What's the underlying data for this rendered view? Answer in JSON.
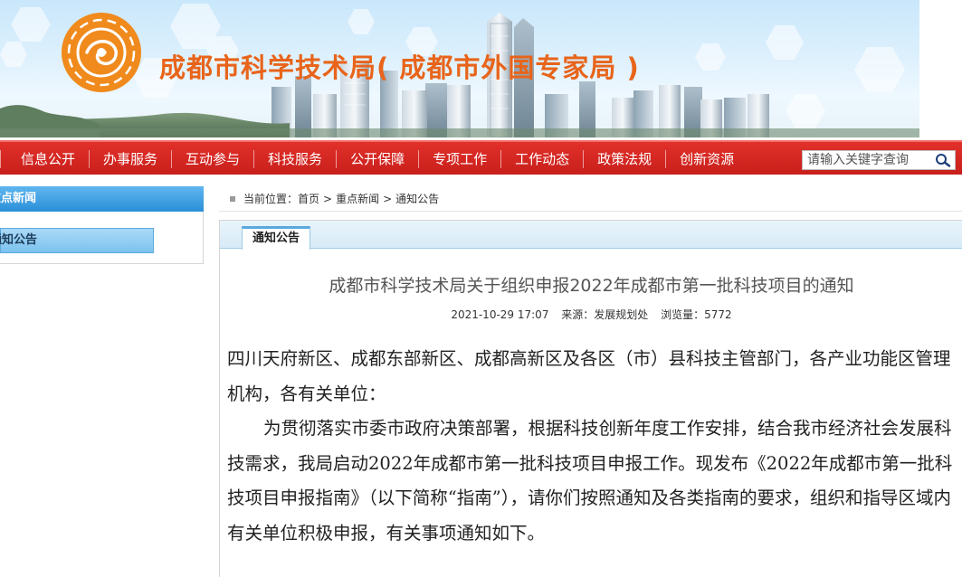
{
  "header": {
    "site_title": "成都市科学技术局( 成都市外国专家局 )"
  },
  "nav": {
    "items": [
      {
        "label": "信息公开"
      },
      {
        "label": "办事服务"
      },
      {
        "label": "互动参与"
      },
      {
        "label": "科技服务"
      },
      {
        "label": "公开保障"
      },
      {
        "label": "专项工作"
      },
      {
        "label": "工作动态"
      },
      {
        "label": "政策法规"
      },
      {
        "label": "创新资源"
      }
    ],
    "search_placeholder": "请输入关键字查询",
    "search_icon": "search-icon"
  },
  "sidebar": {
    "heading": "重点新闻",
    "items": [
      {
        "label": "通知公告"
      }
    ]
  },
  "breadcrumb": {
    "prefix": "当前位置：",
    "items": [
      "首页",
      "重点新闻",
      "通知公告"
    ],
    "separator": ">"
  },
  "panel": {
    "tab_label": "通知公告"
  },
  "article": {
    "title": "成都市科学技术局关于组织申报2022年成都市第一批科技项目的通知",
    "date": "2021-10-29 17:07",
    "source": "来源：发展规划处",
    "views_label": "浏览量：",
    "views": "5772",
    "paragraphs": [
      "四川天府新区、成都东部新区、成都高新区及各区（市）县科技主管部门，各产业功能区管理机构，各有关单位：",
      "为贯彻落实市委市政府决策部署，根据科技创新年度工作安排，结合我市经济社会发展科技需求，我局启动2022年成都市第一批科技项目申报工作。现发布《2022年成都市第一批科技项目申报指南》（以下简称“指南”），请你们按照通知及各类指南的要求，组织和指导区域内有关单位积极申报，有关事项通知如下。"
    ]
  },
  "colors": {
    "nav_red": "#c81f1b",
    "title_orange": "#e8641a",
    "side_blue": "#2a8fd8"
  }
}
